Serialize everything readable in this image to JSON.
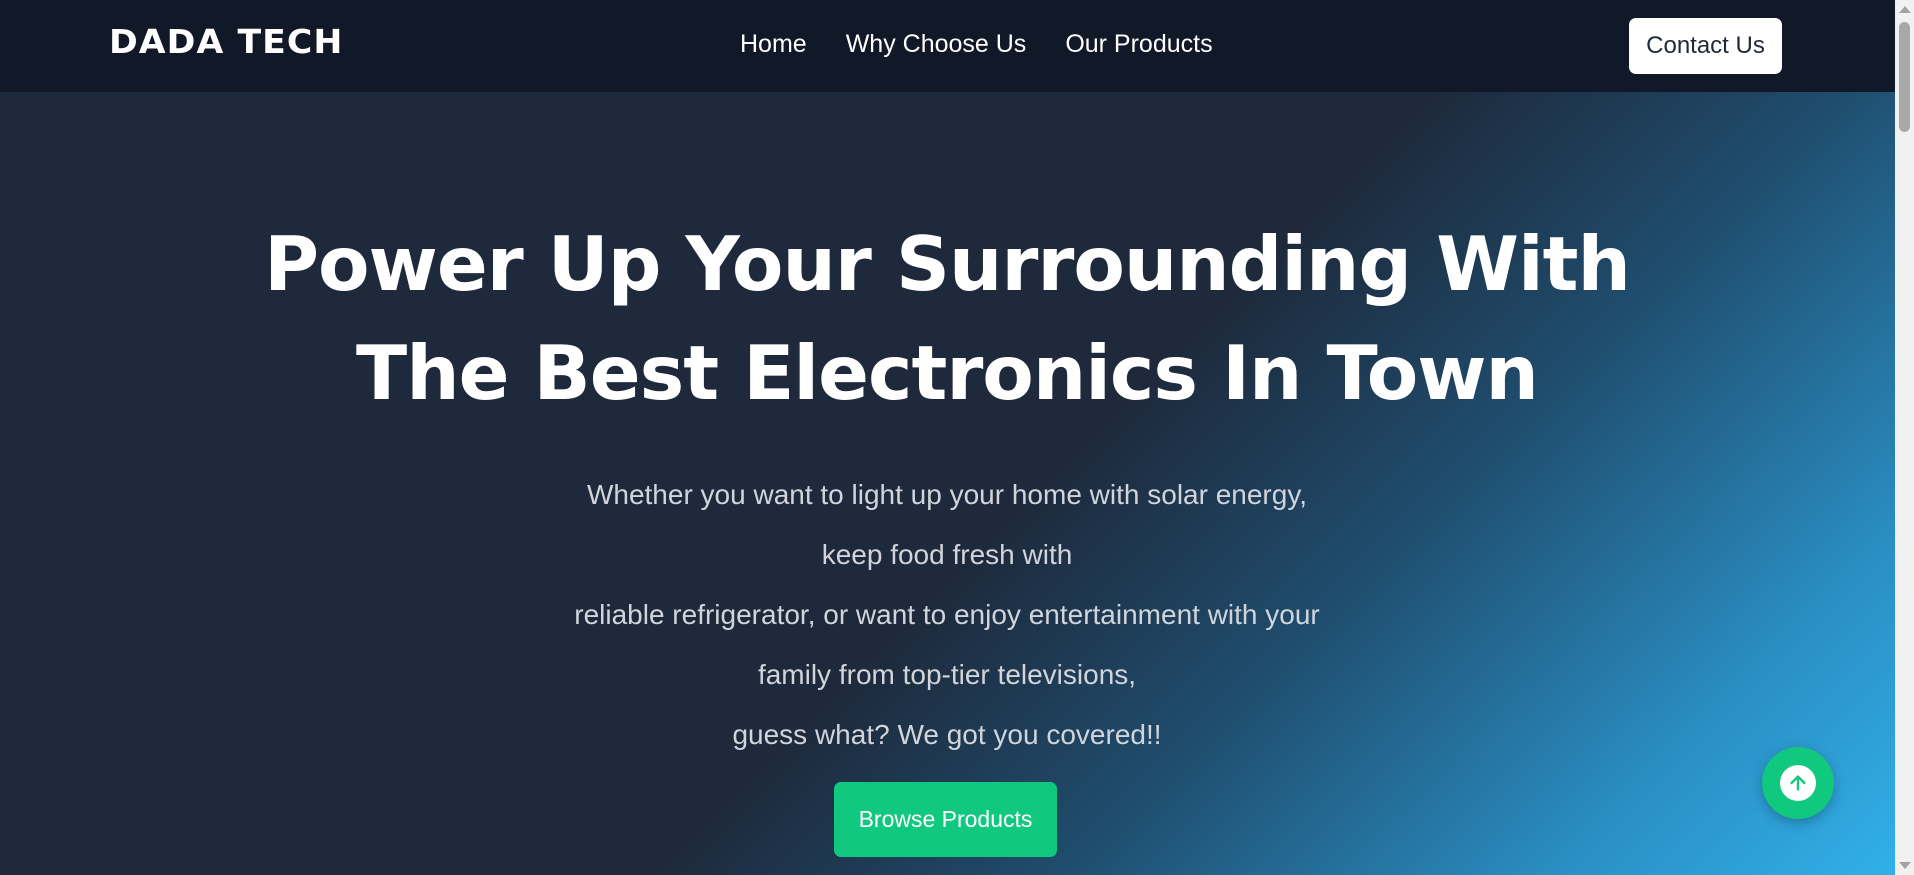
{
  "navbar": {
    "brand": "DADA TECH",
    "links": [
      "Home",
      "Why Choose Us",
      "Our Products"
    ],
    "contact_label": "Contact Us"
  },
  "hero": {
    "title_lines": [
      "Power Up Your Surrounding With",
      "The Best Electronics In Town"
    ],
    "description_lines": [
      "Whether you want to light up your home with solar energy,",
      "keep food fresh with",
      "reliable refrigerator, or want to enjoy entertainment with your",
      "family from top-tier televisions,",
      "guess what? We got you covered!!"
    ],
    "cta_label": "Browse Products"
  },
  "icons": {
    "back_to_top": "arrow-up-icon"
  },
  "colors": {
    "nav_bg": "#111827",
    "hero_bg": "#1e293b",
    "accent_green": "#10c97f",
    "gradient_blue": "#31b0e8"
  }
}
